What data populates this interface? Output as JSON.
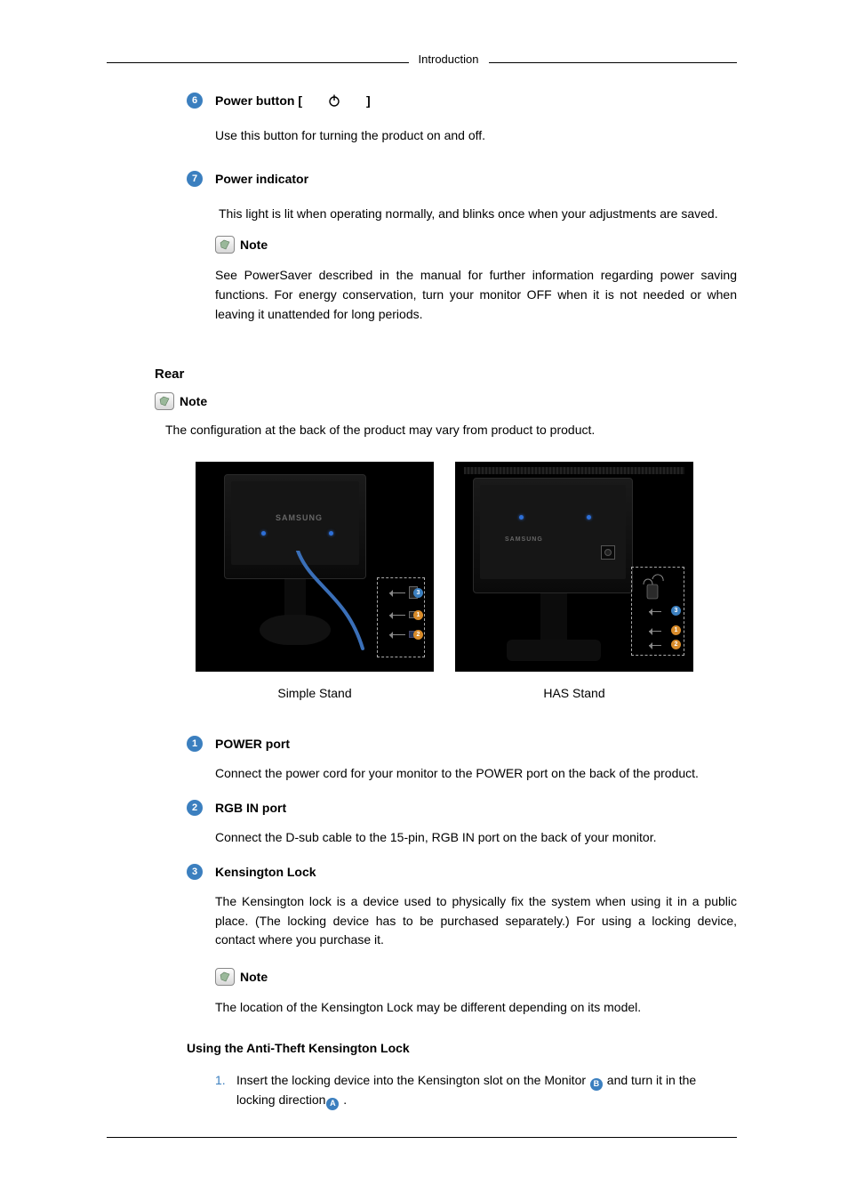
{
  "header": {
    "label": "Introduction"
  },
  "item6": {
    "title": "Power button [",
    "title_after": "]",
    "body": "Use this button for turning the product on and off."
  },
  "item7": {
    "title": "Power indicator",
    "body": "This light is lit when operating normally, and blinks once when your adjustments are saved.",
    "note_label": " Note",
    "note_body": "See PowerSaver described in the manual for further information regarding power saving functions. For energy conservation, turn your monitor OFF when it is not needed or when leaving it unattended for long periods."
  },
  "rear": {
    "heading": "Rear",
    "note_label": " Note",
    "config_text": "The configuration at the back of the product may vary from product to product.",
    "caption_left": "Simple Stand",
    "caption_right": "HAS Stand",
    "logo": "SAMSUNG"
  },
  "port1": {
    "title": "POWER port",
    "body": "Connect the power cord for your monitor to the POWER port on the back of the product."
  },
  "port2": {
    "title": "RGB IN port",
    "body": "Connect the D-sub cable to the 15-pin, RGB IN port on the back of your monitor."
  },
  "port3": {
    "title": "Kensington Lock",
    "body": "The Kensington lock is a device used to physically fix the system when using it in a public place. (The locking device has to be purchased separately.) For using a locking device, contact where you purchase it.",
    "note_label": " Note",
    "note_body": "The location of the Kensington Lock may be different depending on its model."
  },
  "antitheft": {
    "heading": "Using the Anti-Theft Kensington Lock",
    "step_num": "1.",
    "step_a": "Insert the locking device into the Kensington slot on the Monitor ",
    "step_b": " and turn it in the locking direction",
    "step_c": " ."
  }
}
